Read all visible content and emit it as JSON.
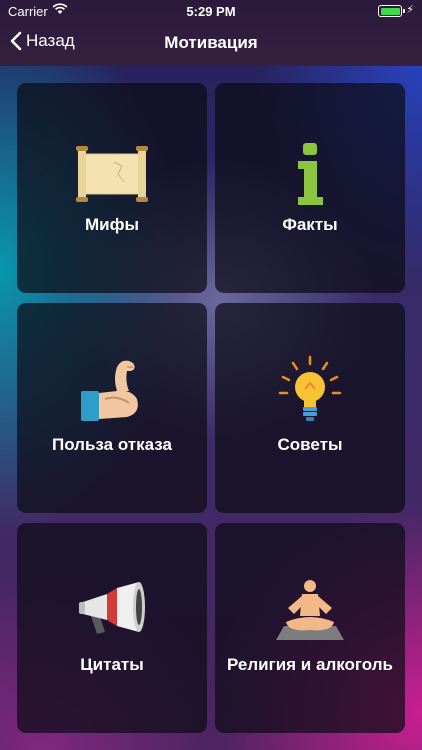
{
  "status_bar": {
    "carrier": "Carrier",
    "time": "5:29 PM"
  },
  "nav": {
    "back_label": "Назад",
    "title": "Мотивация"
  },
  "tiles": [
    {
      "label": "Мифы",
      "icon": "scroll-icon"
    },
    {
      "label": "Факты",
      "icon": "info-icon"
    },
    {
      "label": "Польза отказа",
      "icon": "flexed-arm-icon"
    },
    {
      "label": "Советы",
      "icon": "lightbulb-icon"
    },
    {
      "label": "Цитаты",
      "icon": "megaphone-icon"
    },
    {
      "label": "Религия и алкоголь",
      "icon": "meditation-icon"
    }
  ],
  "colors": {
    "accent_green": "#8BC53F",
    "battery_green": "#3DDC4A",
    "tile_bg": "#0C0C16"
  }
}
